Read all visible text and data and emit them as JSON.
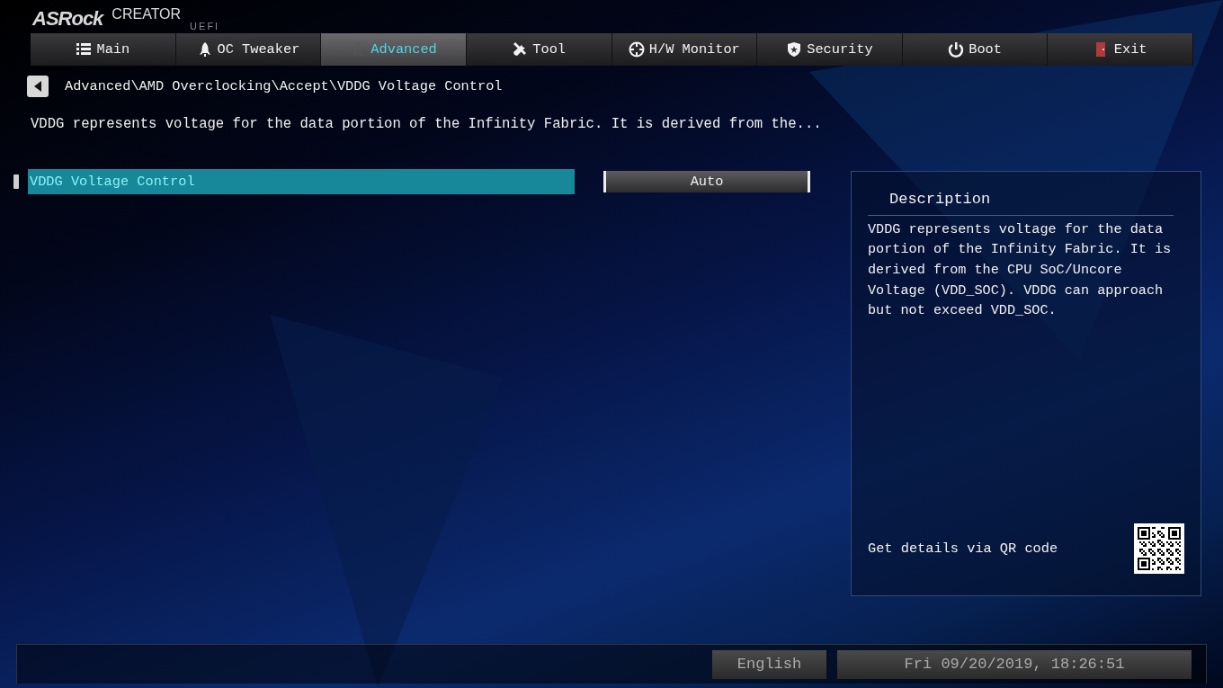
{
  "header": {
    "brand": "ASRock",
    "edition": "CREATOR",
    "subtitle": "UEFI"
  },
  "tabs": [
    {
      "label": "Main",
      "kind": "list",
      "selected": false
    },
    {
      "label": "OC Tweaker",
      "kind": "rocket",
      "selected": false
    },
    {
      "label": "Advanced",
      "kind": "star",
      "selected": true
    },
    {
      "label": "Tool",
      "kind": "tools",
      "selected": false
    },
    {
      "label": "H/W Monitor",
      "kind": "crosshair",
      "selected": false
    },
    {
      "label": "Security",
      "kind": "shield",
      "selected": false
    },
    {
      "label": "Boot",
      "kind": "power",
      "selected": false
    },
    {
      "label": "Exit",
      "kind": "door",
      "selected": false
    }
  ],
  "breadcrumb": "Advanced\\AMD Overclocking\\Accept\\VDDG Voltage Control",
  "help_line": "VDDG represents voltage for the data portion of the Infinity Fabric. It is derived from the...",
  "settings": [
    {
      "label": "VDDG Voltage Control",
      "value": "Auto",
      "selected": true
    }
  ],
  "description": {
    "title": "Description",
    "text": "VDDG represents voltage for the data portion of the Infinity Fabric. It is derived from the CPU SoC/Uncore Voltage (VDD_SOC). VDDG can approach but not exceed VDD_SOC.",
    "qr_hint": "Get details via QR code"
  },
  "status_bar": {
    "language": "English",
    "datetime": "Fri 09/20/2019, 18:26:51"
  }
}
